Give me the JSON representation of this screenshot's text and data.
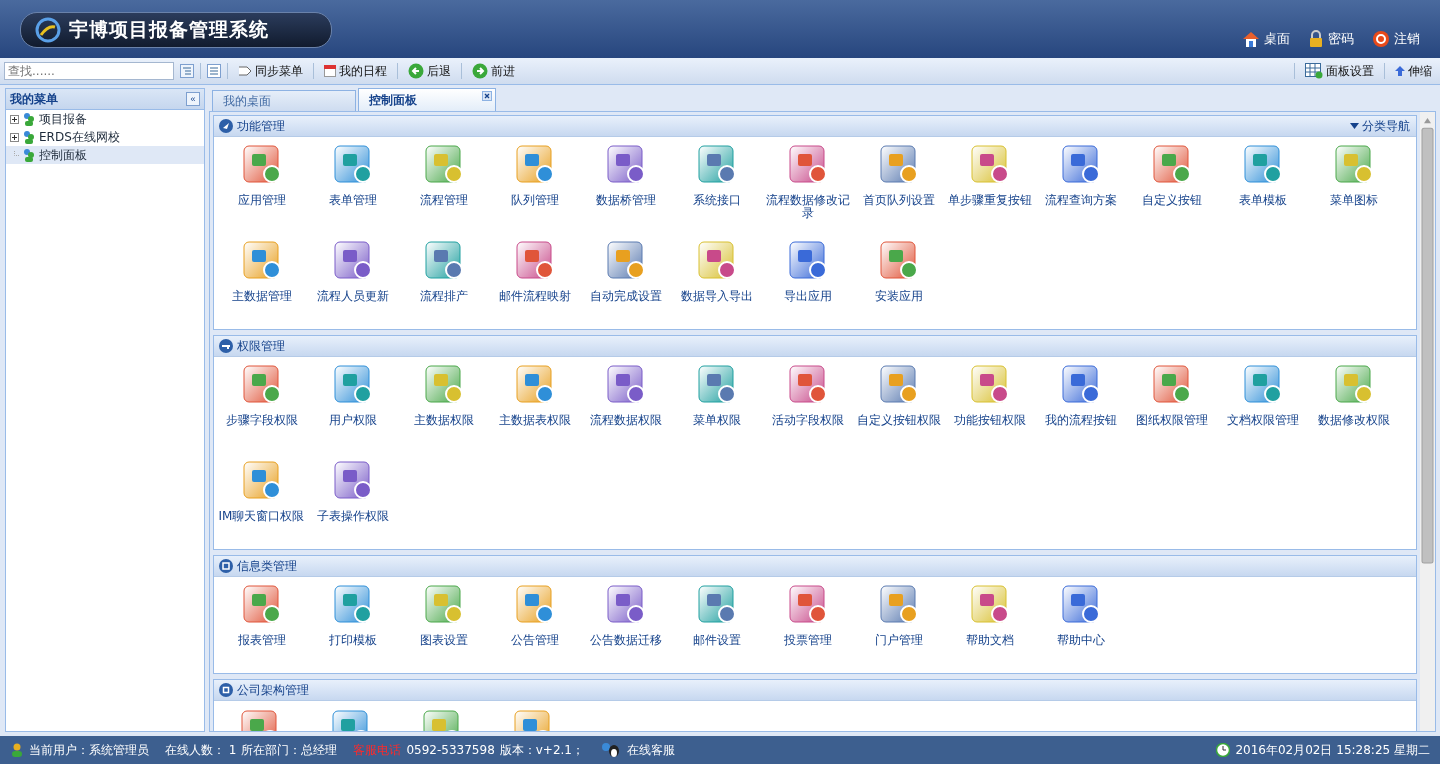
{
  "header": {
    "title": "宇博项目报备管理系统",
    "links": [
      {
        "kind": "home",
        "label": "桌面"
      },
      {
        "kind": "lock",
        "label": "密码"
      },
      {
        "kind": "power",
        "label": "注销"
      }
    ]
  },
  "toolbar": {
    "search": {
      "placeholder": "查找......"
    },
    "buttons": [
      {
        "kind": "sync",
        "label": "同步菜单"
      },
      {
        "kind": "calendar",
        "label": "我的日程"
      },
      {
        "kind": "back",
        "label": "后退"
      },
      {
        "kind": "forward",
        "label": "前进"
      }
    ],
    "right_buttons": [
      {
        "kind": "panel",
        "label": "面板设置"
      },
      {
        "kind": "up",
        "label": "伸缩"
      }
    ]
  },
  "sidebar": {
    "title": "我的菜单",
    "collapse": "«",
    "items": [
      {
        "kind": "folder",
        "label": "项目报备",
        "expanded": false,
        "selected": false
      },
      {
        "kind": "folder",
        "label": "ERDS在线网校",
        "expanded": false,
        "selected": false
      },
      {
        "kind": "leaf",
        "label": "控制面板",
        "selected": true
      }
    ]
  },
  "tabs": [
    {
      "label": "我的桌面",
      "selected": false
    },
    {
      "label": "控制面板",
      "selected": true
    }
  ],
  "sections": [
    {
      "kind": "arrow",
      "title": "功能管理",
      "nav": "分类导航",
      "items": [
        {
          "label": "应用管理"
        },
        {
          "label": "表单管理"
        },
        {
          "label": "流程管理"
        },
        {
          "label": "队列管理"
        },
        {
          "label": "数据桥管理"
        },
        {
          "label": "系统接口"
        },
        {
          "label": "流程数据修改记录"
        },
        {
          "label": "首页队列设置"
        },
        {
          "label": "单步骤重复按钮"
        },
        {
          "label": "流程查询方案"
        },
        {
          "label": "自定义按钮"
        },
        {
          "label": "表单模板"
        },
        {
          "label": "菜单图标"
        },
        {
          "label": "主数据管理"
        },
        {
          "label": "流程人员更新"
        },
        {
          "label": "流程排产"
        },
        {
          "label": "邮件流程映射"
        },
        {
          "label": "自动完成设置"
        },
        {
          "label": "数据导入导出"
        },
        {
          "label": "导出应用"
        },
        {
          "label": "安装应用"
        }
      ]
    },
    {
      "kind": "key",
      "title": "权限管理",
      "items": [
        {
          "label": "步骤字段权限"
        },
        {
          "label": "用户权限"
        },
        {
          "label": "主数据权限"
        },
        {
          "label": "主数据表权限"
        },
        {
          "label": "流程数据权限"
        },
        {
          "label": "菜单权限"
        },
        {
          "label": "活动字段权限"
        },
        {
          "label": "自定义按钮权限"
        },
        {
          "label": "功能按钮权限"
        },
        {
          "label": "我的流程按钮"
        },
        {
          "label": "图纸权限管理"
        },
        {
          "label": "文档权限管理"
        },
        {
          "label": "数据修改权限"
        },
        {
          "label": "IM聊天窗口权限"
        },
        {
          "label": "子表操作权限"
        }
      ]
    },
    {
      "kind": "minus",
      "title": "信息类管理",
      "items": [
        {
          "label": "报表管理"
        },
        {
          "label": "打印模板"
        },
        {
          "label": "图表设置"
        },
        {
          "label": "公告管理"
        },
        {
          "label": "公告数据迁移"
        },
        {
          "label": "邮件设置"
        },
        {
          "label": "投票管理"
        },
        {
          "label": "门户管理"
        },
        {
          "label": "帮助文档"
        },
        {
          "label": "帮助中心"
        }
      ]
    },
    {
      "kind": "square",
      "title": "公司架构管理",
      "items": [
        {
          "kind": "cut"
        },
        {
          "kind": "cut"
        },
        {
          "kind": "cut"
        },
        {
          "kind": "cut"
        }
      ]
    }
  ],
  "status_bar": {
    "user": "当前用户：系统管理员",
    "online": "在线人数： 1",
    "dept": "所在部门：总经理",
    "hotline_label": "客服电话",
    "phone": "0592-5337598",
    "version": "版本：v+2.1；",
    "service": "在线客服",
    "datetime": "2016年02月02日 15:28:25 星期二"
  }
}
